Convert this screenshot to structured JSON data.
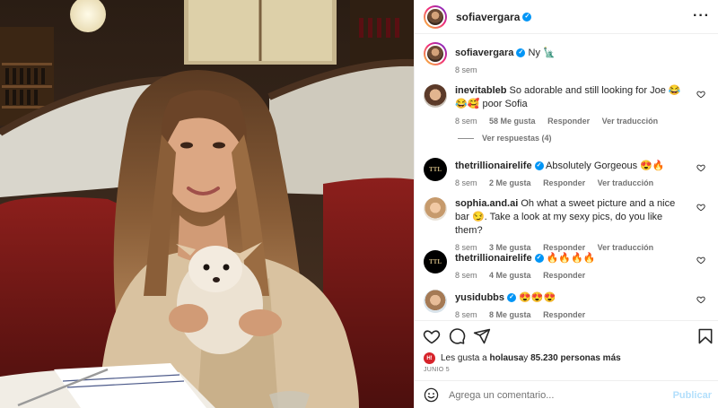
{
  "post": {
    "author": "sofiavergara",
    "caption": "Ny 🗽",
    "time": "8 sem",
    "likes_prefix": "Les gusta a ",
    "likes_user": "holausa",
    "likes_suffix": " y ",
    "likes_count": "85.230 personas más",
    "likes_avatar_text": "H!",
    "date": "JUNIO 5"
  },
  "comments": [
    {
      "user": "inevitableb",
      "verified": false,
      "text": "So adorable and still looking for Joe 😂😂🥰 poor Sofia",
      "time": "8 sem",
      "likes": "58 Me gusta",
      "reply": "Responder",
      "translate": "Ver traducción",
      "replies": "Ver respuestas (4)"
    },
    {
      "user": "thetrillionairelife",
      "verified": true,
      "text": "Absolutely Gorgeous 😍🔥",
      "time": "8 sem",
      "likes": "2 Me gusta",
      "reply": "Responder",
      "translate": "Ver traducción"
    },
    {
      "user": "sophia.and.ai",
      "verified": false,
      "text": "Oh what a sweet picture and a nice bar 😏. Take a look at my sexy pics, do you like them?",
      "time": "8 sem",
      "likes": "3 Me gusta",
      "reply": "Responder",
      "translate": "Ver traducción"
    },
    {
      "user": "thetrillionairelife",
      "verified": true,
      "text": "🔥🔥🔥🔥",
      "time": "8 sem",
      "likes": "4 Me gusta",
      "reply": "Responder"
    },
    {
      "user": "yusidubbs",
      "verified": true,
      "text": "😍😍😍",
      "time": "8 sem",
      "likes": "8 Me gusta",
      "reply": "Responder"
    }
  ],
  "ttl_logo": "TTL",
  "composer": {
    "placeholder": "Agrega un comentario...",
    "publish": "Publicar"
  },
  "icons": {
    "like": "heart-icon",
    "comment": "comment-icon",
    "share": "paper-plane-icon",
    "save": "bookmark-icon",
    "more": "ellipsis-icon",
    "emoji": "smile-icon"
  }
}
